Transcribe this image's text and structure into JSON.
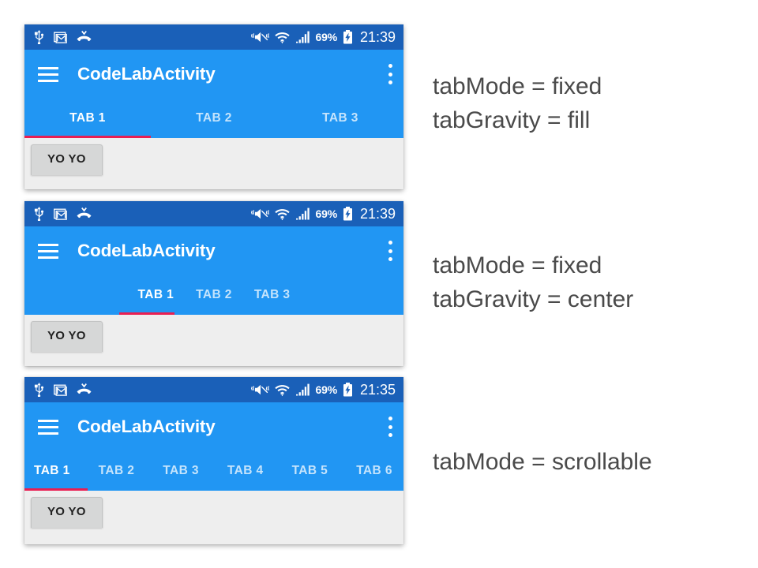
{
  "statusbar": {
    "icons_left": [
      "usb-icon",
      "gmail-icon",
      "missed-call-icon"
    ],
    "icons_right": [
      "vibrate-mute-icon",
      "wifi-icon",
      "signal-bars-icon",
      "battery-charging-icon"
    ],
    "battery_percent": "69%",
    "clock_1": "21:39",
    "clock_2": "21:39",
    "clock_3": "21:35"
  },
  "toolbar": {
    "menu_icon": "hamburger-menu-icon",
    "title": "CodeLabActivity",
    "overflow_icon": "overflow-menu-icon"
  },
  "content": {
    "button_label": "YO YO"
  },
  "panels": [
    {
      "id": "panel-fixed-fill",
      "mode": "fill",
      "tabs": [
        {
          "label": "TAB 1",
          "active": true
        },
        {
          "label": "TAB 2",
          "active": false
        },
        {
          "label": "TAB 3",
          "active": false
        }
      ],
      "annotation": "tabMode = fixed\ntabGravity = fill"
    },
    {
      "id": "panel-fixed-center",
      "mode": "center",
      "tabs": [
        {
          "label": "TAB 1",
          "active": true
        },
        {
          "label": "TAB 2",
          "active": false
        },
        {
          "label": "TAB 3",
          "active": false
        }
      ],
      "annotation": "tabMode = fixed\ntabGravity = center"
    },
    {
      "id": "panel-scrollable",
      "mode": "scroll",
      "tabs": [
        {
          "label": "TAB 1",
          "active": true
        },
        {
          "label": "TAB 2",
          "active": false
        },
        {
          "label": "TAB 3",
          "active": false
        },
        {
          "label": "TAB 4",
          "active": false
        },
        {
          "label": "TAB 5",
          "active": false
        },
        {
          "label": "TAB 6",
          "active": false
        }
      ],
      "annotation": "tabMode = scrollable"
    }
  ],
  "colors": {
    "statusbar": "#1a60b8",
    "appbar": "#2196f3",
    "indicator": "#e91e52",
    "content_bg": "#eeeeee",
    "annotation_text": "#4a4a4a"
  }
}
